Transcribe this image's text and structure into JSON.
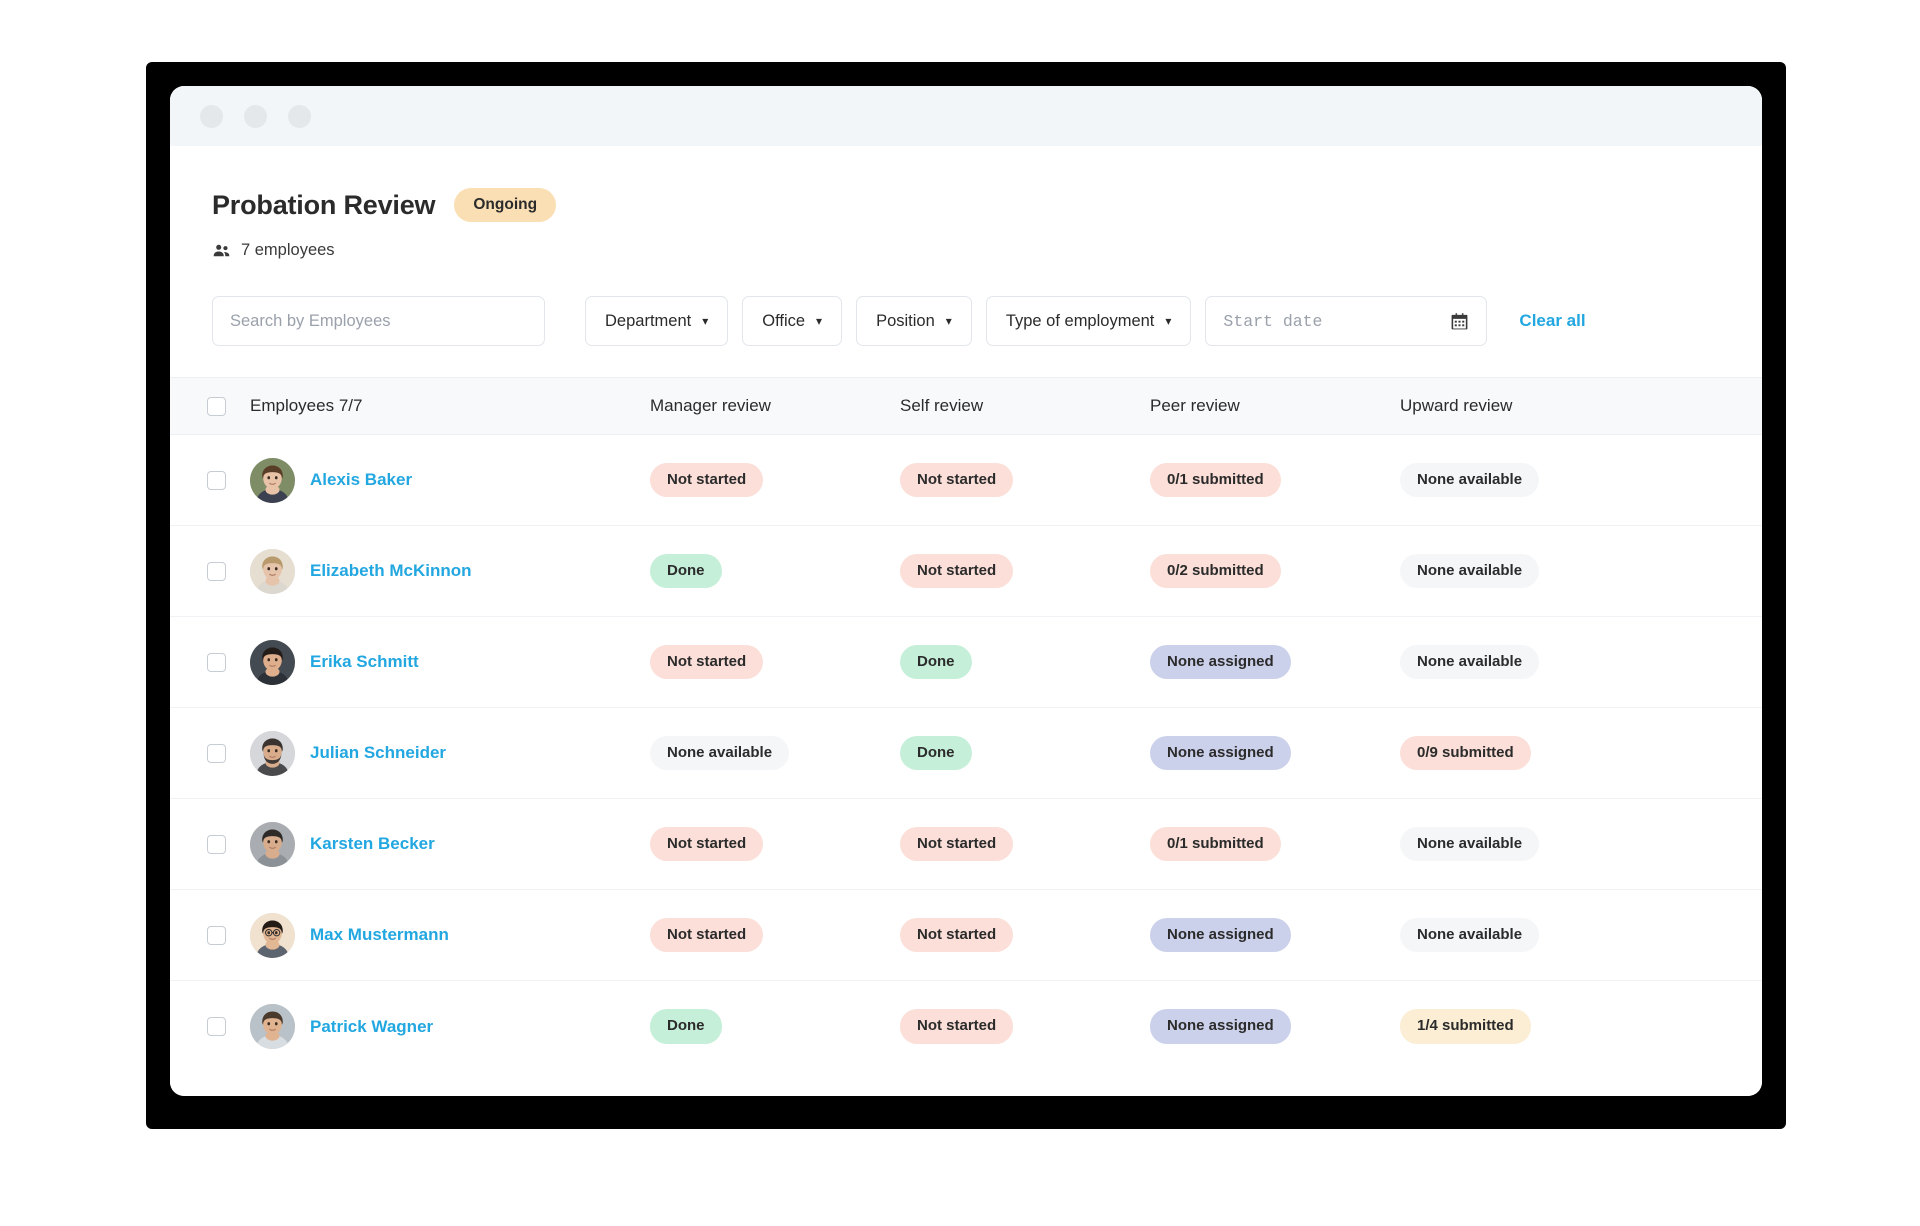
{
  "window": {
    "dots": [
      "close-dot",
      "minimize-dot",
      "maximize-dot"
    ]
  },
  "header": {
    "title": "Probation Review",
    "status": "Ongoing",
    "employee_count": "7 employees",
    "people_icon": "people-icon"
  },
  "filters": {
    "search_placeholder": "Search by Employees",
    "search_value": "",
    "dropdowns": [
      {
        "label": "Department"
      },
      {
        "label": "Office"
      },
      {
        "label": "Position"
      },
      {
        "label": "Type of employment"
      }
    ],
    "date_placeholder": "Start date",
    "date_value": "",
    "calendar_icon": "calendar-icon",
    "clear_all": "Clear all"
  },
  "table": {
    "columns": [
      "Employees 7/7",
      "Manager review",
      "Self review",
      "Peer review",
      "Upward review"
    ],
    "rows": [
      {
        "name": "Alexis Baker",
        "avatar": "woman-brown-hair",
        "manager": {
          "text": "Not started",
          "style": "notstarted"
        },
        "self": {
          "text": "Not started",
          "style": "notstarted"
        },
        "peer": {
          "text": "0/1 submitted",
          "style": "submitted0"
        },
        "upward": {
          "text": "None available",
          "style": "noneavail"
        }
      },
      {
        "name": "Elizabeth McKinnon",
        "avatar": "woman-blonde",
        "manager": {
          "text": "Done",
          "style": "done"
        },
        "self": {
          "text": "Not started",
          "style": "notstarted"
        },
        "peer": {
          "text": "0/2 submitted",
          "style": "submitted0"
        },
        "upward": {
          "text": "None available",
          "style": "noneavail"
        }
      },
      {
        "name": "Erika Schmitt",
        "avatar": "woman-dark-hair",
        "manager": {
          "text": "Not started",
          "style": "notstarted"
        },
        "self": {
          "text": "Done",
          "style": "done"
        },
        "peer": {
          "text": "None assigned",
          "style": "noneassign"
        },
        "upward": {
          "text": "None available",
          "style": "noneavail"
        }
      },
      {
        "name": "Julian Schneider",
        "avatar": "man-beard",
        "manager": {
          "text": "None available",
          "style": "noneavail"
        },
        "self": {
          "text": "Done",
          "style": "done"
        },
        "peer": {
          "text": "None assigned",
          "style": "noneassign"
        },
        "upward": {
          "text": "0/9 submitted",
          "style": "submitted0"
        }
      },
      {
        "name": "Karsten Becker",
        "avatar": "man-grey-shirt",
        "manager": {
          "text": "Not started",
          "style": "notstarted"
        },
        "self": {
          "text": "Not started",
          "style": "notstarted"
        },
        "peer": {
          "text": "0/1 submitted",
          "style": "submitted0"
        },
        "upward": {
          "text": "None available",
          "style": "noneavail"
        }
      },
      {
        "name": "Max Mustermann",
        "avatar": "man-glasses",
        "manager": {
          "text": "Not started",
          "style": "notstarted"
        },
        "self": {
          "text": "Not started",
          "style": "notstarted"
        },
        "peer": {
          "text": "None assigned",
          "style": "noneassign"
        },
        "upward": {
          "text": "None available",
          "style": "noneavail"
        }
      },
      {
        "name": "Patrick Wagner",
        "avatar": "man-short-hair",
        "manager": {
          "text": "Done",
          "style": "done"
        },
        "self": {
          "text": "Not started",
          "style": "notstarted"
        },
        "peer": {
          "text": "None assigned",
          "style": "noneassign"
        },
        "upward": {
          "text": "1/4 submitted",
          "style": "submittedp"
        }
      }
    ]
  },
  "colors": {
    "accent_blue": "#22a7e0",
    "status_pill": "#fbdfb4",
    "badge_not_started": "#fbdfd8",
    "badge_done": "#c5efd8",
    "badge_none_available": "#f4f6f8",
    "badge_none_assigned": "#ccd1eb",
    "badge_partial": "#fbeed4"
  }
}
